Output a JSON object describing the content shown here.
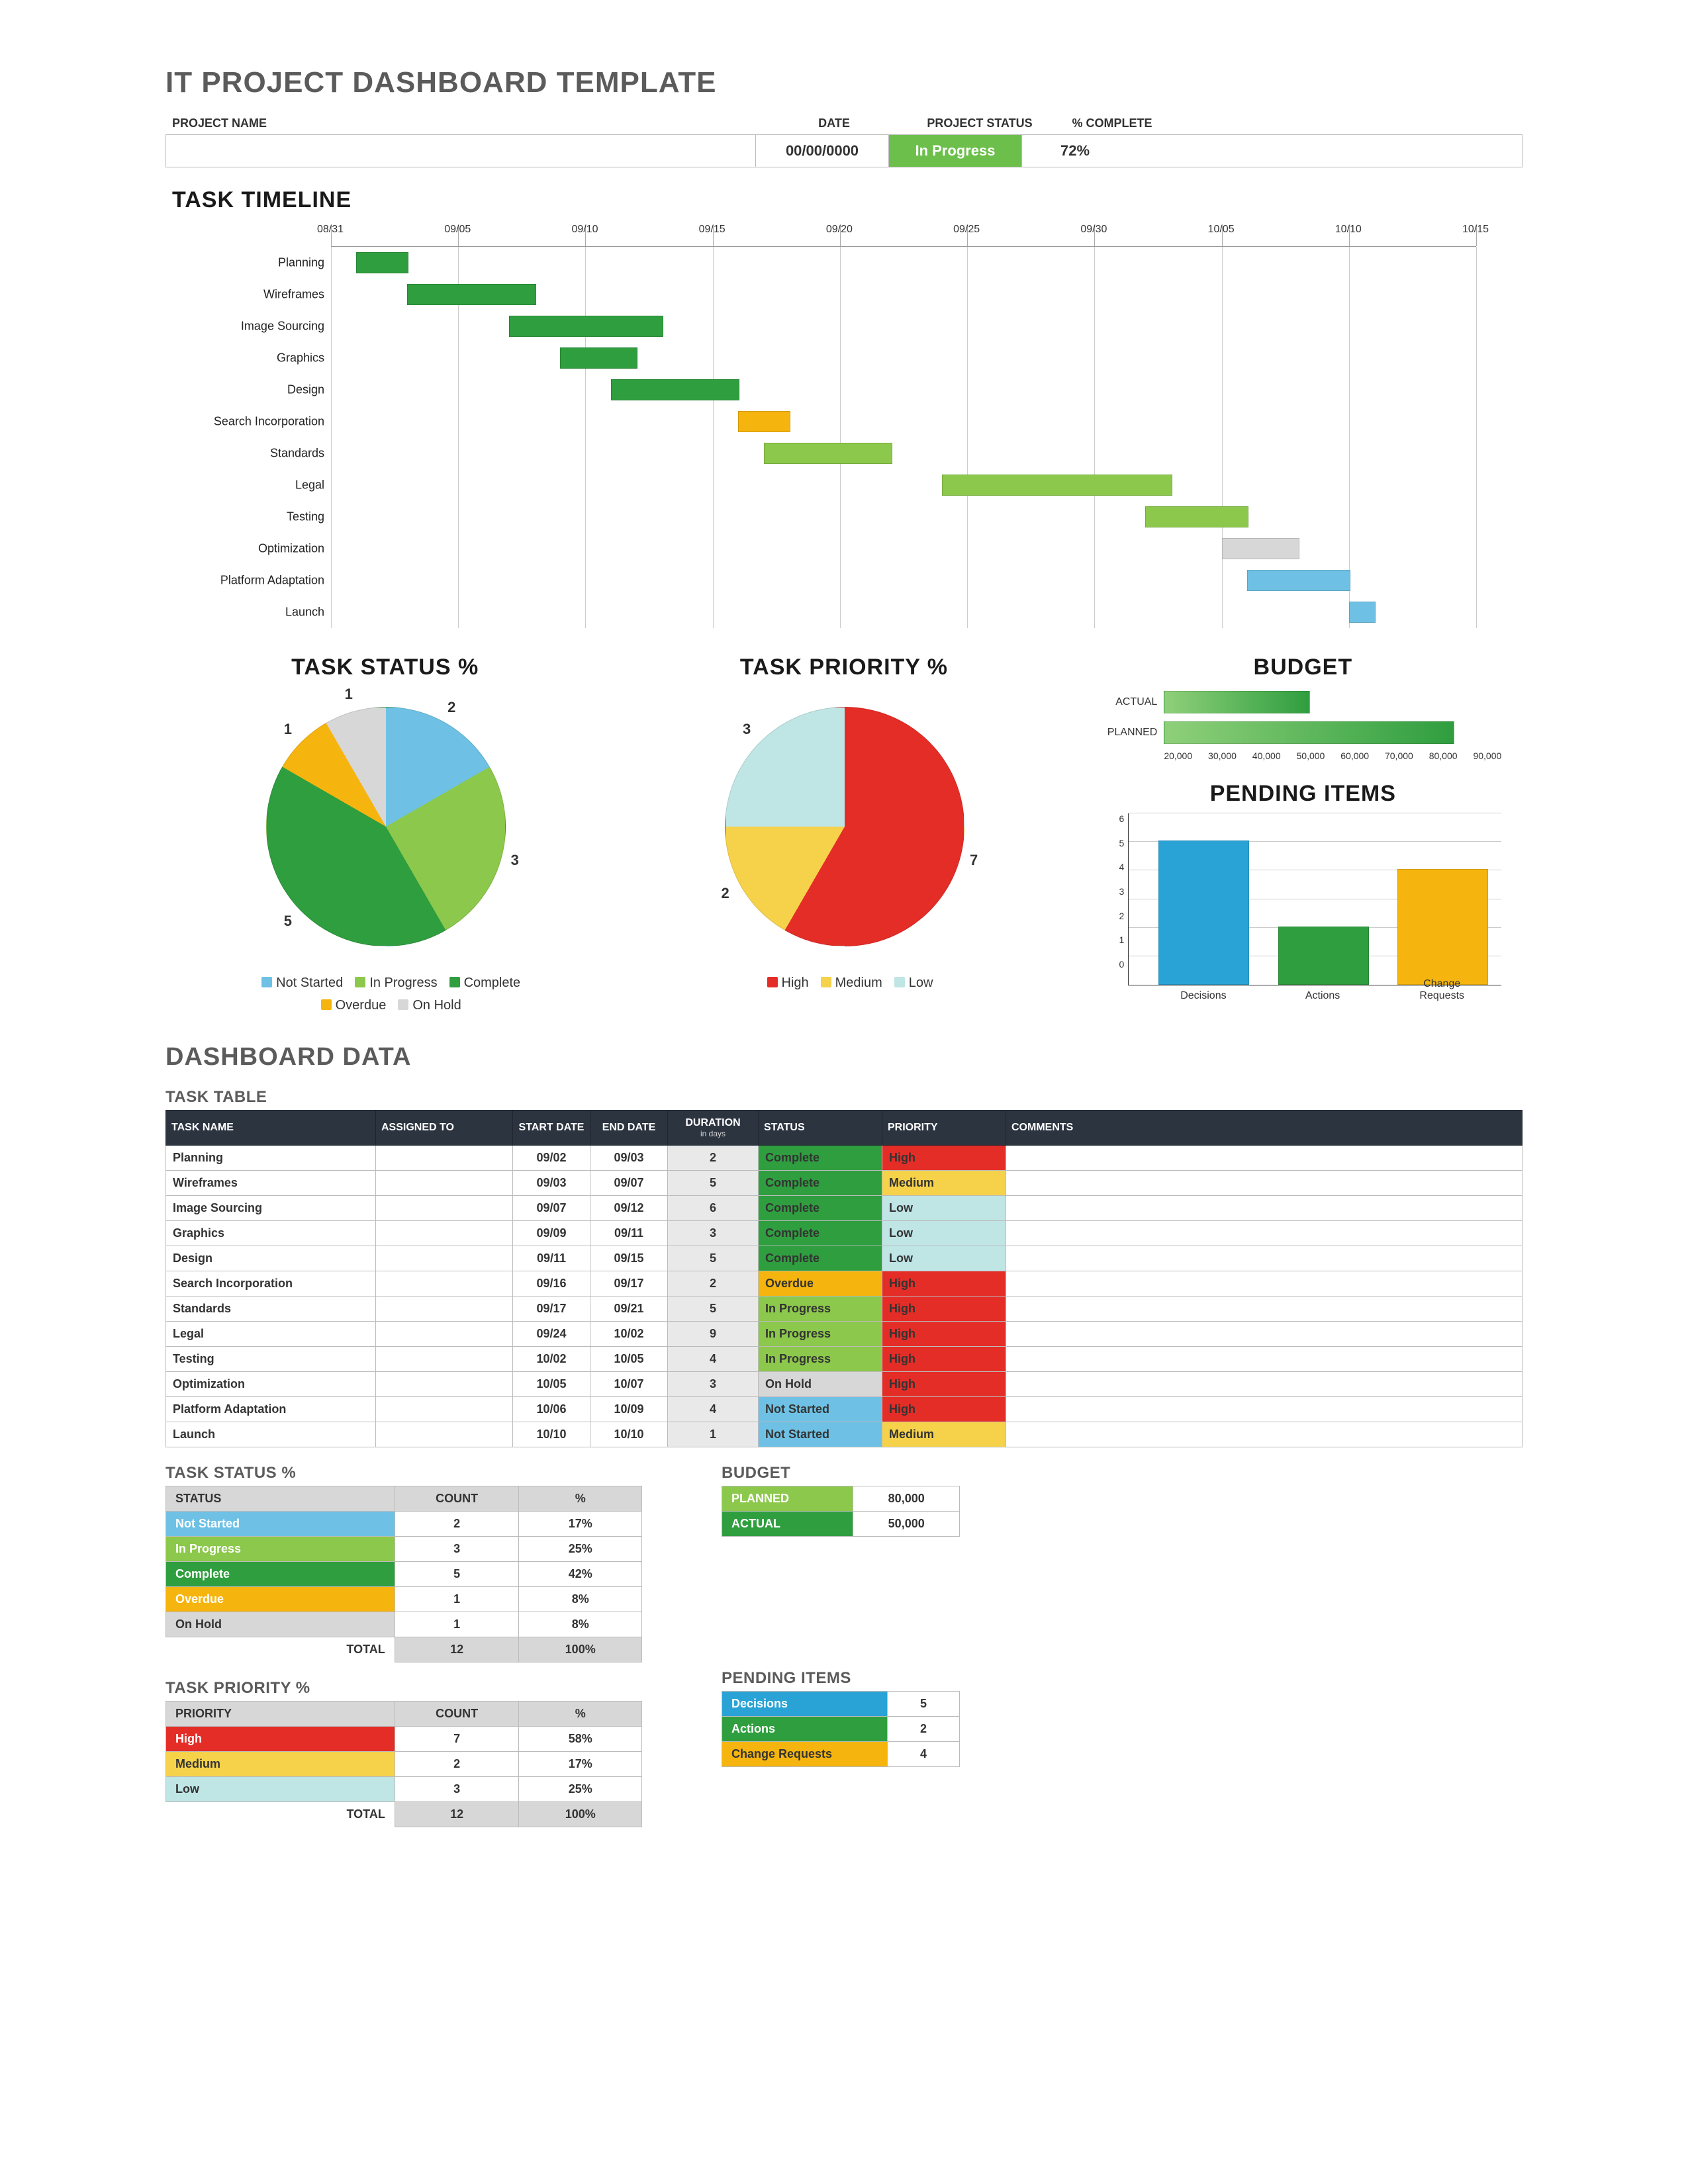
{
  "title": "IT PROJECT DASHBOARD TEMPLATE",
  "header": {
    "labels": {
      "name": "PROJECT NAME",
      "date": "DATE",
      "status": "PROJECT  STATUS",
      "pct": "% COMPLETE"
    },
    "name": " ",
    "date": "00/00/0000",
    "status": "In Progress",
    "pct": "72%"
  },
  "sections": {
    "timeline": "TASK TIMELINE",
    "taskStatus": "TASK STATUS %",
    "taskPriority": "TASK PRIORITY %",
    "budget": "BUDGET",
    "pending": "PENDING ITEMS",
    "dashboard": "DASHBOARD DATA",
    "taskTable": "TASK TABLE",
    "statusTbl": "TASK STATUS %",
    "priorityTbl": "TASK PRIORITY %",
    "budgetTbl": "BUDGET",
    "pendingTbl": "PENDING ITEMS"
  },
  "colors": {
    "notStarted": "#6ec1e4",
    "inProgress": "#8cc84b",
    "complete": "#2f9e3f",
    "overdue": "#f6b50e",
    "onHold": "#d7d7d7",
    "high": "#e52d27",
    "medium": "#f6d24a",
    "low": "#bfe5e5",
    "decisions": "#29a3d6",
    "actions": "#2f9e3f",
    "changes": "#f6b50e"
  },
  "chart_data": [
    {
      "type": "gantt",
      "title": "TASK TIMELINE",
      "axis": {
        "start": "08/31",
        "end": "10/15",
        "ticks": [
          "08/31",
          "09/05",
          "09/10",
          "09/15",
          "09/20",
          "09/25",
          "09/30",
          "10/05",
          "10/10",
          "10/15"
        ],
        "days": 45
      },
      "tasks": [
        {
          "name": "Planning",
          "start": 1,
          "duration": 2,
          "status": "Complete"
        },
        {
          "name": "Wireframes",
          "start": 3,
          "duration": 5,
          "status": "Complete"
        },
        {
          "name": "Image Sourcing",
          "start": 7,
          "duration": 6,
          "status": "Complete"
        },
        {
          "name": "Graphics",
          "start": 9,
          "duration": 3,
          "status": "Complete"
        },
        {
          "name": "Design",
          "start": 11,
          "duration": 5,
          "status": "Complete"
        },
        {
          "name": "Search Incorporation",
          "start": 16,
          "duration": 2,
          "status": "Overdue"
        },
        {
          "name": "Standards",
          "start": 17,
          "duration": 5,
          "status": "In Progress"
        },
        {
          "name": "Legal",
          "start": 24,
          "duration": 9,
          "status": "In Progress"
        },
        {
          "name": "Testing",
          "start": 32,
          "duration": 4,
          "status": "In Progress"
        },
        {
          "name": "Optimization",
          "start": 35,
          "duration": 3,
          "status": "On Hold"
        },
        {
          "name": "Platform Adaptation",
          "start": 36,
          "duration": 4,
          "status": "Not Started"
        },
        {
          "name": "Launch",
          "start": 40,
          "duration": 1,
          "status": "Not Started"
        }
      ]
    },
    {
      "type": "pie",
      "title": "TASK STATUS %",
      "series": [
        {
          "name": "Not Started",
          "value": 2
        },
        {
          "name": "In Progress",
          "value": 3
        },
        {
          "name": "Complete",
          "value": 5
        },
        {
          "name": "Overdue",
          "value": 1
        },
        {
          "name": "On Hold",
          "value": 1
        }
      ]
    },
    {
      "type": "pie",
      "title": "TASK PRIORITY %",
      "series": [
        {
          "name": "High",
          "value": 7
        },
        {
          "name": "Medium",
          "value": 2
        },
        {
          "name": "Low",
          "value": 3
        }
      ]
    },
    {
      "type": "bar",
      "title": "BUDGET",
      "orientation": "horizontal",
      "categories": [
        "ACTUAL",
        "PLANNED"
      ],
      "values": [
        50000,
        80000
      ],
      "xlim": [
        20000,
        90000
      ],
      "xticks": [
        20000,
        30000,
        40000,
        50000,
        60000,
        70000,
        80000,
        90000
      ],
      "xtick_labels": [
        "20,000",
        "30,000",
        "40,000",
        "50,000",
        "60,000",
        "70,000",
        "80,000",
        "90,000"
      ]
    },
    {
      "type": "bar",
      "title": "PENDING ITEMS",
      "categories": [
        "Decisions",
        "Actions",
        "Change Requests"
      ],
      "values": [
        5,
        2,
        4
      ],
      "ylim": [
        0,
        6
      ],
      "yticks": [
        0,
        1,
        2,
        3,
        4,
        5,
        6
      ]
    }
  ],
  "legend": {
    "status": [
      "Not Started",
      "In Progress",
      "Complete",
      "Overdue",
      "On Hold"
    ],
    "priority": [
      "High",
      "Medium",
      "Low"
    ]
  },
  "taskTable": {
    "headers": {
      "name": "TASK NAME",
      "assigned": "ASSIGNED TO",
      "start": "START DATE",
      "end": "END DATE",
      "dur": "DURATION",
      "durSub": "in days",
      "status": "STATUS",
      "priority": "PRIORITY",
      "comments": "COMMENTS"
    },
    "rows": [
      {
        "name": "Planning",
        "assigned": "",
        "start": "09/02",
        "end": "09/03",
        "dur": "2",
        "status": "Complete",
        "priority": "High",
        "comments": ""
      },
      {
        "name": "Wireframes",
        "assigned": "",
        "start": "09/03",
        "end": "09/07",
        "dur": "5",
        "status": "Complete",
        "priority": "Medium",
        "comments": ""
      },
      {
        "name": "Image Sourcing",
        "assigned": "",
        "start": "09/07",
        "end": "09/12",
        "dur": "6",
        "status": "Complete",
        "priority": "Low",
        "comments": ""
      },
      {
        "name": "Graphics",
        "assigned": "",
        "start": "09/09",
        "end": "09/11",
        "dur": "3",
        "status": "Complete",
        "priority": "Low",
        "comments": ""
      },
      {
        "name": "Design",
        "assigned": "",
        "start": "09/11",
        "end": "09/15",
        "dur": "5",
        "status": "Complete",
        "priority": "Low",
        "comments": ""
      },
      {
        "name": "Search Incorporation",
        "assigned": "",
        "start": "09/16",
        "end": "09/17",
        "dur": "2",
        "status": "Overdue",
        "priority": "High",
        "comments": ""
      },
      {
        "name": "Standards",
        "assigned": "",
        "start": "09/17",
        "end": "09/21",
        "dur": "5",
        "status": "In Progress",
        "priority": "High",
        "comments": ""
      },
      {
        "name": "Legal",
        "assigned": "",
        "start": "09/24",
        "end": "10/02",
        "dur": "9",
        "status": "In Progress",
        "priority": "High",
        "comments": ""
      },
      {
        "name": "Testing",
        "assigned": "",
        "start": "10/02",
        "end": "10/05",
        "dur": "4",
        "status": "In Progress",
        "priority": "High",
        "comments": ""
      },
      {
        "name": "Optimization",
        "assigned": "",
        "start": "10/05",
        "end": "10/07",
        "dur": "3",
        "status": "On Hold",
        "priority": "High",
        "comments": ""
      },
      {
        "name": "Platform Adaptation",
        "assigned": "",
        "start": "10/06",
        "end": "10/09",
        "dur": "4",
        "status": "Not Started",
        "priority": "High",
        "comments": ""
      },
      {
        "name": "Launch",
        "assigned": "",
        "start": "10/10",
        "end": "10/10",
        "dur": "1",
        "status": "Not Started",
        "priority": "Medium",
        "comments": ""
      }
    ]
  },
  "statusTable": {
    "headers": {
      "status": "STATUS",
      "count": "COUNT",
      "pct": "%"
    },
    "rows": [
      {
        "status": "Not Started",
        "count": "2",
        "pct": "17%"
      },
      {
        "status": "In Progress",
        "count": "3",
        "pct": "25%"
      },
      {
        "status": "Complete",
        "count": "5",
        "pct": "42%"
      },
      {
        "status": "Overdue",
        "count": "1",
        "pct": "8%"
      },
      {
        "status": "On Hold",
        "count": "1",
        "pct": "8%"
      }
    ],
    "totalLabel": "TOTAL",
    "totalCount": "12",
    "totalPct": "100%"
  },
  "priorityTable": {
    "headers": {
      "priority": "PRIORITY",
      "count": "COUNT",
      "pct": "%"
    },
    "rows": [
      {
        "priority": "High",
        "count": "7",
        "pct": "58%"
      },
      {
        "priority": "Medium",
        "count": "2",
        "pct": "17%"
      },
      {
        "priority": "Low",
        "count": "3",
        "pct": "25%"
      }
    ],
    "totalLabel": "TOTAL",
    "totalCount": "12",
    "totalPct": "100%"
  },
  "budgetTable": {
    "rows": [
      {
        "label": "PLANNED",
        "value": "80,000"
      },
      {
        "label": "ACTUAL",
        "value": "50,000"
      }
    ]
  },
  "pendingTable": {
    "rows": [
      {
        "label": "Decisions",
        "value": "5"
      },
      {
        "label": "Actions",
        "value": "2"
      },
      {
        "label": "Change Requests",
        "value": "4"
      }
    ]
  }
}
